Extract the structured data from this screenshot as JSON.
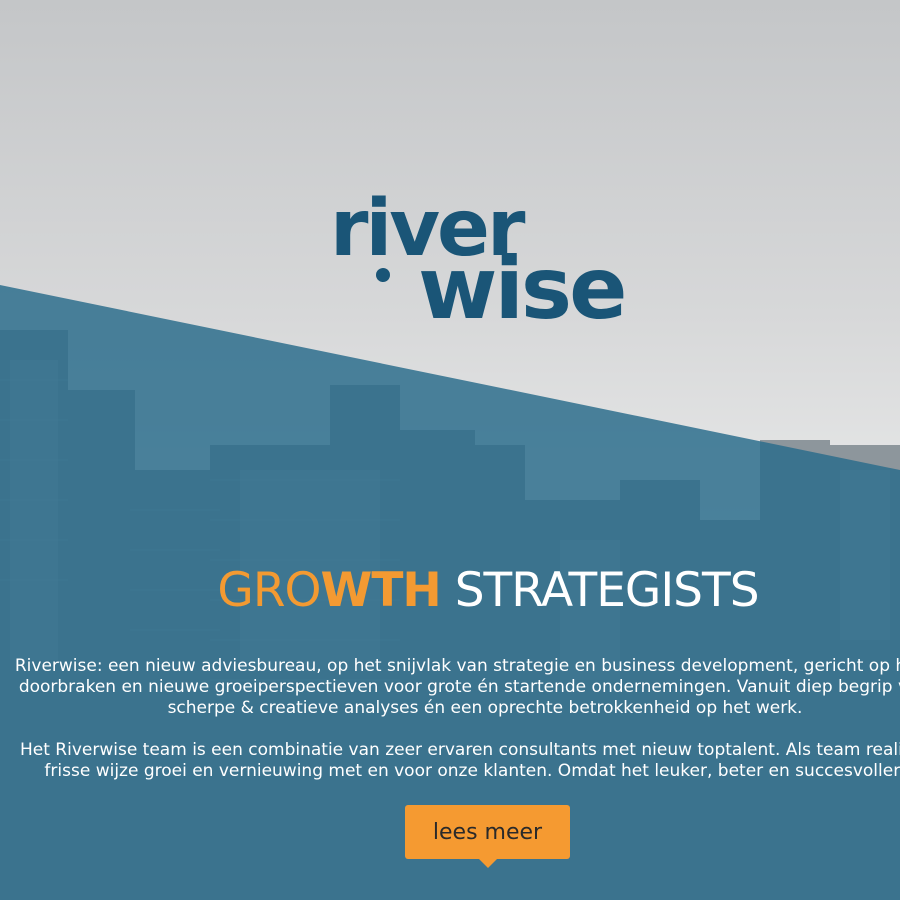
{
  "brand": {
    "logo_line1": "river",
    "logo_line2": "wise",
    "color": "#1a5577"
  },
  "hero": {
    "headline_part1": "GRO",
    "headline_part2": "WTH",
    "headline_part3": " STRATEGISTS",
    "accent_color": "#f39a32",
    "overlay_color": "#2b6c8c",
    "paragraph1": [
      "Riverwise: een nieuw adviesbureau, op het snijvlak van strategie en business development, gericht op het cre",
      "doorbraken en nieuwe groeiperspectieven voor grote én startende ondernemingen. Vanuit diep begrip van m",
      "scherpe & creatieve analyses én een oprechte betrokkenheid op het werk."
    ],
    "paragraph2": [
      "Het Riverwise team is een combinatie van zeer ervaren consultants met nieuw toptalent. Als team realiseren",
      "frisse wijze groei en vernieuwing met en voor onze klanten. Omdat het leuker, beter en succesvoller ka"
    ],
    "cta_label": "lees meer"
  }
}
